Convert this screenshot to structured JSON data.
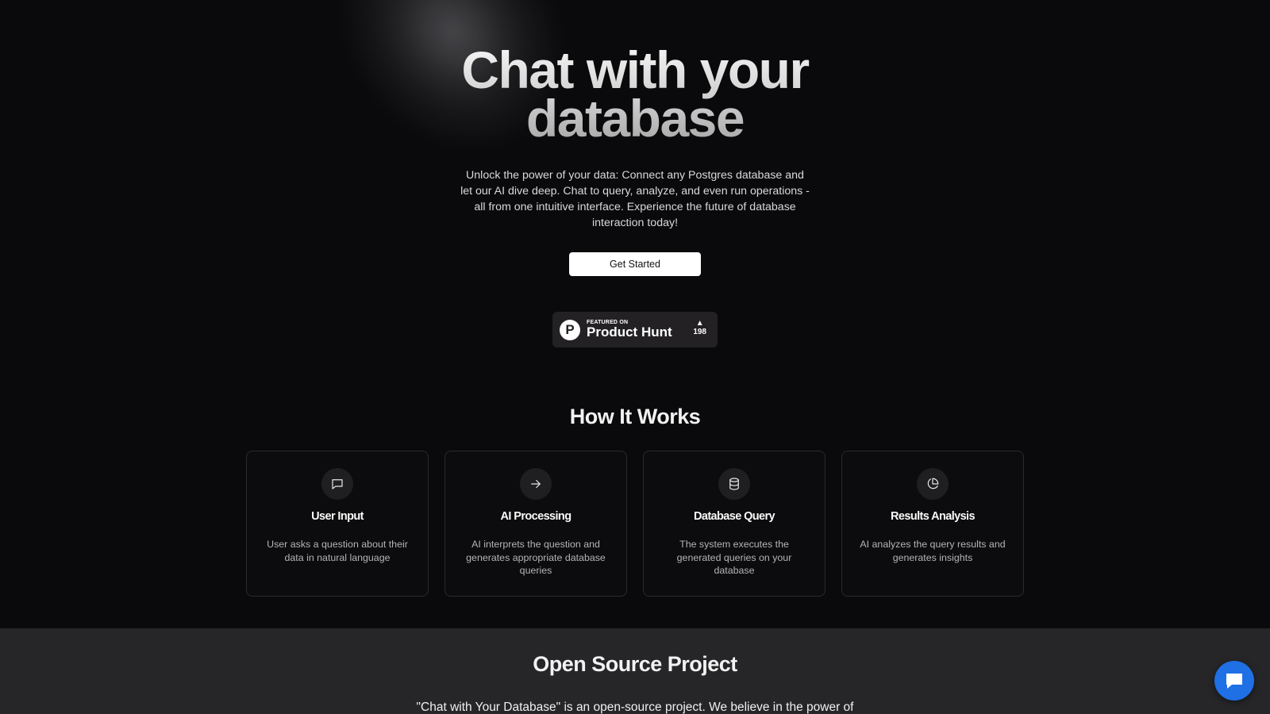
{
  "hero": {
    "title_line1": "Chat with your",
    "title_line2": "database",
    "description": "Unlock the power of your data: Connect any Postgres database and let our AI dive deep. Chat to query, analyze, and even run operations - all from one intuitive interface. Experience the future of database interaction today!",
    "cta_label": "Get Started"
  },
  "product_hunt": {
    "featured_label": "FEATURED ON",
    "name": "Product Hunt",
    "logo_letter": "P",
    "vote_arrow": "▲",
    "votes": "198"
  },
  "how_it_works": {
    "title": "How It Works",
    "steps": [
      {
        "icon": "message-square-icon",
        "title": "User Input",
        "description": "User asks a question about their data in natural language"
      },
      {
        "icon": "arrow-right-icon",
        "title": "AI Processing",
        "description": "AI interprets the question and generates appropriate database queries"
      },
      {
        "icon": "database-icon",
        "title": "Database Query",
        "description": "The system executes the generated queries on your database"
      },
      {
        "icon": "pie-chart-icon",
        "title": "Results Analysis",
        "description": "AI analyzes the query results and generates insights"
      }
    ]
  },
  "open_source": {
    "title": "Open Source Project",
    "text": "\"Chat with Your Database\" is an open-source project. We believe in the power of"
  },
  "chat_widget": {
    "icon": "chat-bubble-icon",
    "color": "#1f6fe5"
  }
}
